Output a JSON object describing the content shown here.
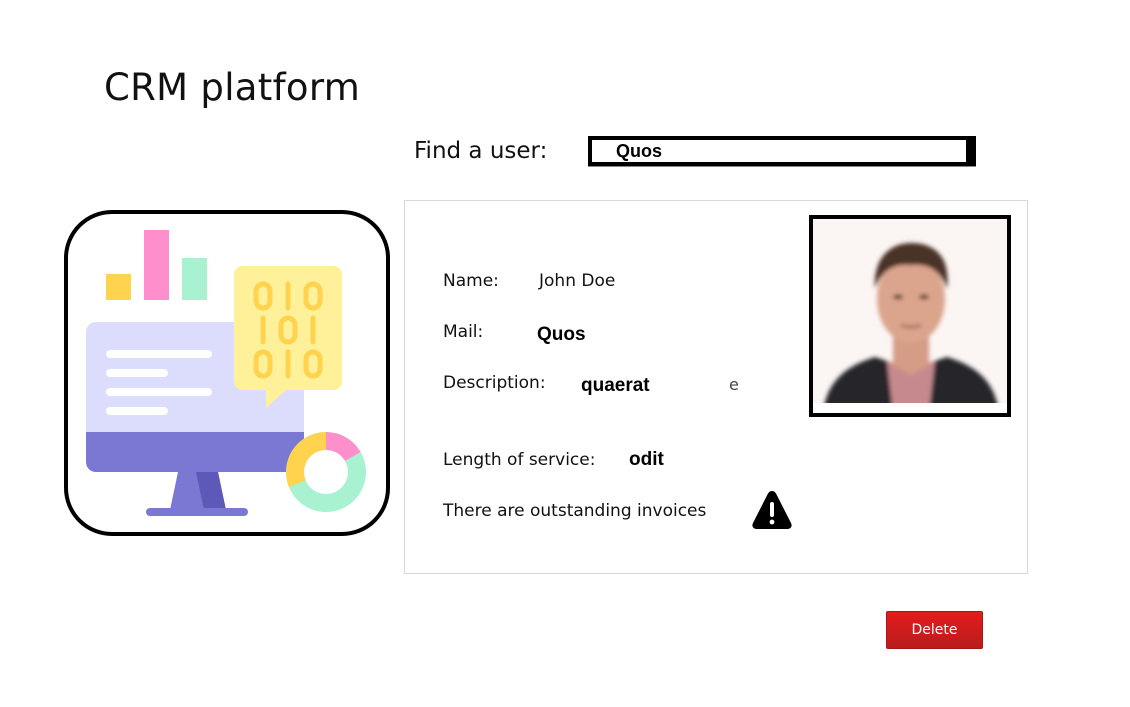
{
  "app": {
    "title": "CRM platform"
  },
  "search": {
    "label": "Find a user:",
    "value": "Quos"
  },
  "illustration": {
    "icon": "crm-dashboard-icon",
    "binary_rows": [
      "010",
      "101",
      "010"
    ],
    "colors": {
      "bar_yellow": "#ffd34e",
      "bar_pink": "#ff8fcc",
      "bar_green": "#a8f2d2",
      "monitor_screen": "#dcdcfc",
      "monitor_base": "#7b78d4",
      "bubble": "#fff09a",
      "bubble_text": "#ffd34e"
    }
  },
  "user_card": {
    "name_label": "Name:",
    "name_value": "John Doe",
    "mail_label": "Mail:",
    "mail_value": "Quos",
    "description_label": "Description:",
    "description_value": "quaerat",
    "description_trailing": "e",
    "service_label": "Length of service:",
    "service_value": "odit",
    "invoices_text": "There are outstanding invoices",
    "warning_icon": "warning-triangle-icon",
    "photo": "user-photo"
  },
  "actions": {
    "delete_label": "Delete",
    "delete_color": "#d81f1f"
  }
}
